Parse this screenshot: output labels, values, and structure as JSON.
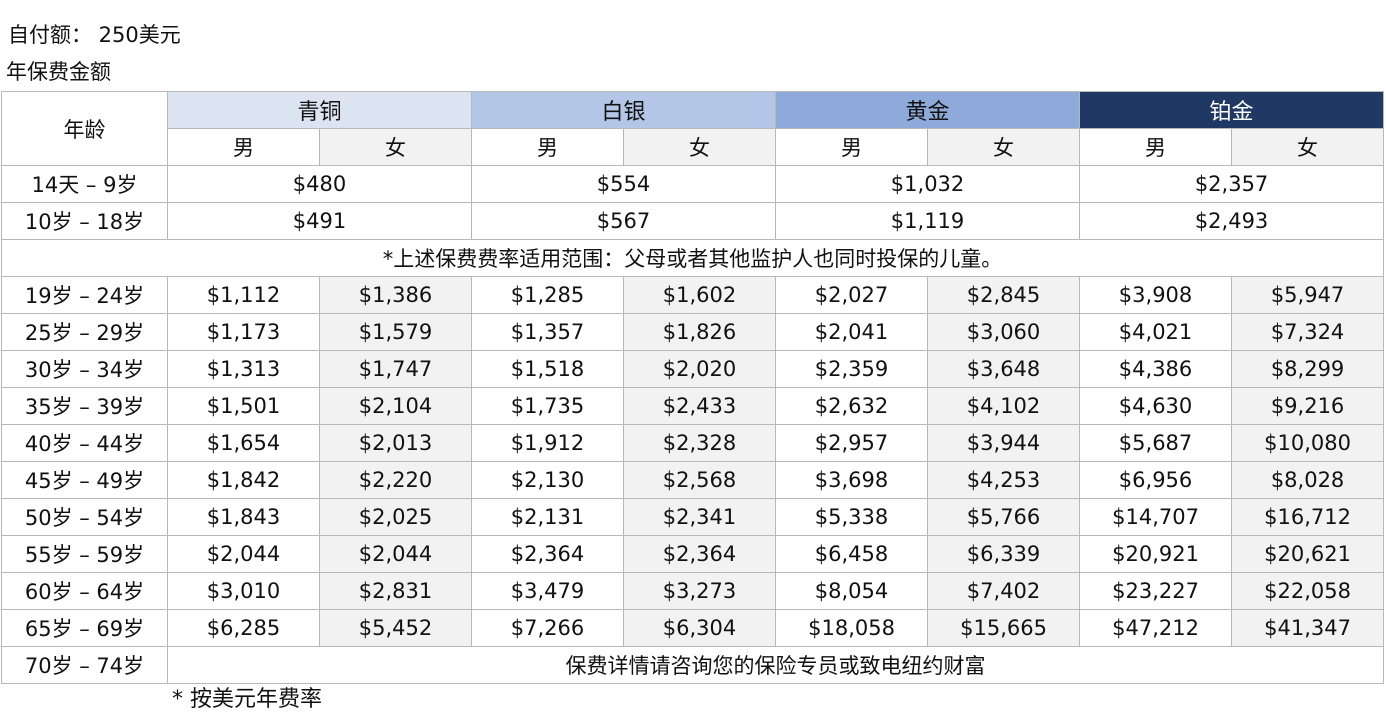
{
  "deductible": "自付额： 250美元",
  "caption": "年保费金额",
  "header": {
    "age": "年龄",
    "tiers": [
      "青铜",
      "白银",
      "黄金",
      "铂金"
    ],
    "male": "男",
    "female": "女"
  },
  "child_rows": [
    {
      "age": "14天 – 9岁",
      "values": [
        "$480",
        "$554",
        "$1,032",
        "$2,357"
      ]
    },
    {
      "age": "10岁 – 18岁",
      "values": [
        "$491",
        "$567",
        "$1,119",
        "$2,493"
      ]
    }
  ],
  "child_note": "*上述保费费率适用范围：父母或者其他监护人也同时投保的儿童。",
  "adult_rows": [
    {
      "age": "19岁 – 24岁",
      "values": [
        "$1,112",
        "$1,386",
        "$1,285",
        "$1,602",
        "$2,027",
        "$2,845",
        "$3,908",
        "$5,947"
      ]
    },
    {
      "age": "25岁 – 29岁",
      "values": [
        "$1,173",
        "$1,579",
        "$1,357",
        "$1,826",
        "$2,041",
        "$3,060",
        "$4,021",
        "$7,324"
      ]
    },
    {
      "age": "30岁 – 34岁",
      "values": [
        "$1,313",
        "$1,747",
        "$1,518",
        "$2,020",
        "$2,359",
        "$3,648",
        "$4,386",
        "$8,299"
      ]
    },
    {
      "age": "35岁 – 39岁",
      "values": [
        "$1,501",
        "$2,104",
        "$1,735",
        "$2,433",
        "$2,632",
        "$4,102",
        "$4,630",
        "$9,216"
      ]
    },
    {
      "age": "40岁 – 44岁",
      "values": [
        "$1,654",
        "$2,013",
        "$1,912",
        "$2,328",
        "$2,957",
        "$3,944",
        "$5,687",
        "$10,080"
      ]
    },
    {
      "age": "45岁 – 49岁",
      "values": [
        "$1,842",
        "$2,220",
        "$2,130",
        "$2,568",
        "$3,698",
        "$4,253",
        "$6,956",
        "$8,028"
      ]
    },
    {
      "age": "50岁 – 54岁",
      "values": [
        "$1,843",
        "$2,025",
        "$2,131",
        "$2,341",
        "$5,338",
        "$5,766",
        "$14,707",
        "$16,712"
      ]
    },
    {
      "age": "55岁 – 59岁",
      "values": [
        "$2,044",
        "$2,044",
        "$2,364",
        "$2,364",
        "$6,458",
        "$6,339",
        "$20,921",
        "$20,621"
      ]
    },
    {
      "age": "60岁 – 64岁",
      "values": [
        "$3,010",
        "$2,831",
        "$3,479",
        "$3,273",
        "$8,054",
        "$7,402",
        "$23,227",
        "$22,058"
      ]
    },
    {
      "age": "65岁 – 69岁",
      "values": [
        "$6,285",
        "$5,452",
        "$7,266",
        "$6,304",
        "$18,058",
        "$15,665",
        "$47,212",
        "$41,347"
      ]
    }
  ],
  "senior_row": {
    "age": "70岁 – 74岁",
    "note": "保费详情请咨询您的保险专员或致电纽约财富"
  },
  "footnote": "* 按美元年费率",
  "colors": {
    "bronze": "#dce3f1",
    "silver": "#b3c6e7",
    "gold": "#8eaadb",
    "platinum": "#1f3864",
    "female_column": "#f2f2f2"
  }
}
